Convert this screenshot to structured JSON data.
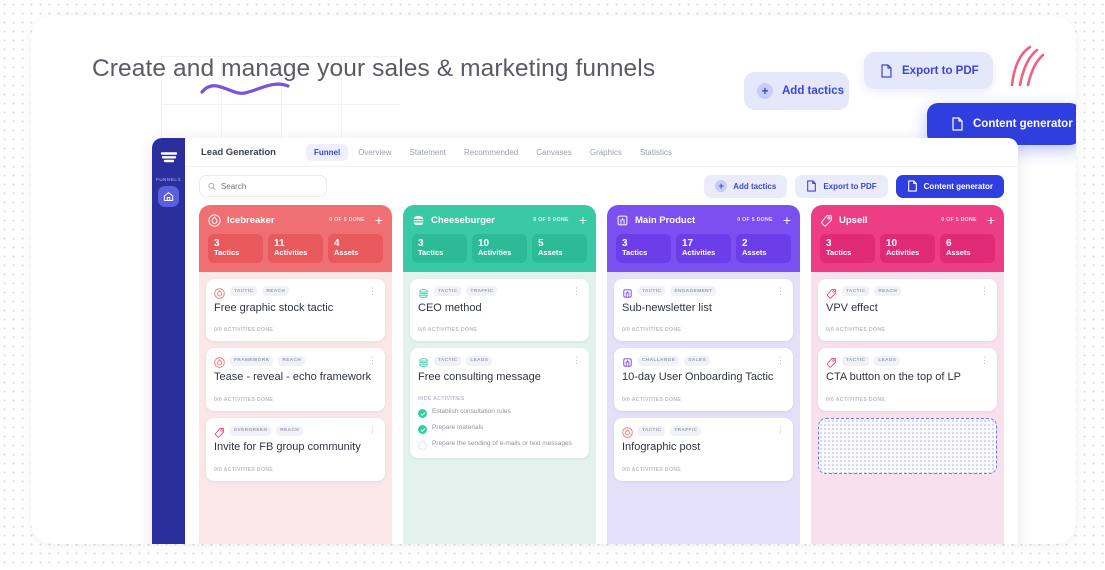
{
  "page": {
    "headline": "Create and manage your sales & marketing funnels"
  },
  "floating_buttons": {
    "add_tactics": "Add tactics",
    "export_pdf": "Export to PDF",
    "content_generator": "Content generator"
  },
  "sidebar": {
    "label": "FUNNELS",
    "logo_icon": "funnel-logo-icon",
    "home_icon": "home-icon"
  },
  "nav": {
    "title": "Lead Generation",
    "tabs": [
      {
        "label": "Funnel",
        "active": true
      },
      {
        "label": "Overview",
        "active": false
      },
      {
        "label": "Statement",
        "active": false
      },
      {
        "label": "Recommended",
        "active": false
      },
      {
        "label": "Canvases",
        "active": false
      },
      {
        "label": "Graphics",
        "active": false
      },
      {
        "label": "Statistics",
        "active": false
      }
    ]
  },
  "toolbar": {
    "search_placeholder": "Search",
    "search_value": "",
    "search_icon": "search-icon",
    "add_tactics": "Add tactics",
    "export_pdf": "Export to PDF",
    "content_generator": "Content generator"
  },
  "colors": {
    "brand_blue": "#2f3fdf",
    "sidebar_blue": "#2b2f9e",
    "col_icebreaker": "#ef6f73",
    "col_cheeseburger": "#3ac9a5",
    "col_main_product": "#7b4ff0",
    "col_upsell": "#ed3d84",
    "check_green": "#2ecfa0"
  },
  "board": {
    "stat_labels": {
      "tactics": "Tactics",
      "activities": "Activities",
      "assets": "Assets"
    },
    "columns": [
      {
        "name": "Icebreaker",
        "icon": "flame-icon",
        "done": "0 OF 5 DONE",
        "add_label": "+",
        "header_bg": "#ef6f73",
        "stat_bg": "#e8595e",
        "body_bg": "#fbe7e8",
        "tactics": "3",
        "activities": "11",
        "assets": "4",
        "cards": [
          {
            "icon": "flame-icon",
            "icon_color": "#ef6f73",
            "chips": [
              "TACTIC",
              "REACH"
            ],
            "title": "Free graphic stock tactic",
            "footer": "0/0 ACTIVITIES DONE",
            "menu_icon": "kebab-menu-icon"
          },
          {
            "icon": "flame-icon",
            "icon_color": "#ef6f73",
            "chips": [
              "FRAMEWORK",
              "REACH"
            ],
            "title": "Tease - reveal - echo framework",
            "footer": "0/0 ACTIVITIES DONE",
            "menu_icon": "kebab-menu-icon"
          },
          {
            "icon": "tag-icon",
            "icon_color": "#ed3d84",
            "chips": [
              "EVERGREEN",
              "REACH"
            ],
            "title": "Invite for FB group community",
            "footer": "0/0 ACTIVITIES DONE",
            "menu_icon": "kebab-menu-icon"
          }
        ]
      },
      {
        "name": "Cheeseburger",
        "icon": "burger-icon",
        "done": "0 OF 5 DONE",
        "add_label": "+",
        "header_bg": "#3ac9a5",
        "stat_bg": "#2cba97",
        "body_bg": "#e2f3ee",
        "tactics": "3",
        "activities": "10",
        "assets": "5",
        "cards": [
          {
            "icon": "burger-icon",
            "icon_color": "#3ac9a5",
            "chips": [
              "TACTIC",
              "TRAFFIC"
            ],
            "title": "CEO method",
            "footer": "0/0 ACTIVITIES DONE",
            "menu_icon": "kebab-menu-icon"
          },
          {
            "icon": "burger-icon",
            "icon_color": "#3ac9a5",
            "chips": [
              "TACTIC",
              "LEADS"
            ],
            "title": "Free consulting message",
            "hide_activities": "HIDE ACTIVITIES",
            "menu_icon": "kebab-menu-icon",
            "activities": [
              {
                "text": "Establish consultation rules",
                "done": true
              },
              {
                "text": "Prepare materials",
                "done": true
              },
              {
                "text": "Prepare the sending of e-mails or text messages",
                "done": false
              }
            ]
          }
        ]
      },
      {
        "name": "Main Product",
        "icon": "building-icon",
        "done": "0 OF 5 DONE",
        "add_label": "+",
        "header_bg": "#7b4ff0",
        "stat_bg": "#6c3eea",
        "body_bg": "#e5e0fa",
        "tactics": "3",
        "activities": "17",
        "assets": "2",
        "cards": [
          {
            "icon": "building-icon",
            "icon_color": "#6c3eea",
            "chips": [
              "TACTIC",
              "ENGAGEMENT"
            ],
            "title": "Sub-newsletter list",
            "footer": "0/0 ACTIVITIES DONE",
            "menu_icon": "kebab-menu-icon"
          },
          {
            "icon": "building-icon",
            "icon_color": "#6c3eea",
            "chips": [
              "CHALLANGE",
              "SALES"
            ],
            "title": "10-day User Onboarding Tactic",
            "footer": "0/0 ACTIVITIES DONE",
            "menu_icon": "kebab-menu-icon"
          },
          {
            "icon": "flame-icon",
            "icon_color": "#ef6f73",
            "chips": [
              "TACTIC",
              "TRAFFIC"
            ],
            "title": "Infographic post",
            "footer": "0/0 ACTIVITIES DONE",
            "menu_icon": "kebab-menu-icon"
          }
        ]
      },
      {
        "name": "Upsell",
        "icon": "tag-icon",
        "done": "0 OF 5 DONE",
        "add_label": "+",
        "header_bg": "#ed3d84",
        "stat_bg": "#e02a76",
        "body_bg": "#f8e1ec",
        "tactics": "3",
        "activities": "10",
        "assets": "6",
        "cards": [
          {
            "icon": "tag-icon",
            "icon_color": "#ed3d84",
            "chips": [
              "TACTIC",
              "REACH"
            ],
            "title": "VPV effect",
            "footer": "0/0 ACTIVITIES DONE",
            "menu_icon": "kebab-menu-icon"
          },
          {
            "icon": "tag-icon",
            "icon_color": "#ed3d84",
            "chips": [
              "TACTIC",
              "LEADS"
            ],
            "title": "CTA button on the top of LP",
            "footer": "0/0 ACTIVITIES DONE",
            "menu_icon": "kebab-menu-icon"
          }
        ],
        "has_dropzone": true
      }
    ]
  }
}
